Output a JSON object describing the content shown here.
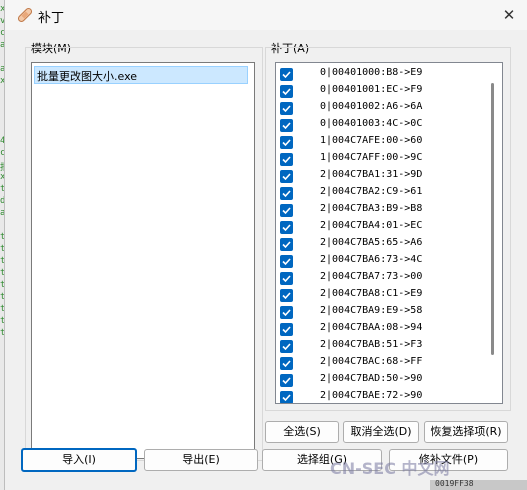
{
  "window": {
    "title": "补丁",
    "close_glyph": "✕"
  },
  "modules": {
    "label": "模块(M)",
    "items": [
      "批量更改图大小.exe"
    ]
  },
  "patches": {
    "label": "补丁(A)",
    "items": [
      "0|00401000:B8->E9",
      "0|00401001:EC->F9",
      "0|00401002:A6->6A",
      "0|00401003:4C->0C",
      "1|004C7AFE:00->60",
      "1|004C7AFF:00->9C",
      "2|004C7BA1:31->9D",
      "2|004C7BA2:C9->61",
      "2|004C7BA3:B9->B8",
      "2|004C7BA4:01->EC",
      "2|004C7BA5:65->A6",
      "2|004C7BA6:73->4C",
      "2|004C7BA7:73->00",
      "2|004C7BA8:C1->E9",
      "2|004C7BA9:E9->58",
      "2|004C7BAA:08->94",
      "2|004C7BAB:51->F3",
      "2|004C7BAC:68->FF",
      "2|004C7BAD:50->90",
      "2|004C7BAE:72->90"
    ]
  },
  "buttons": {
    "select_all": "全选(S)",
    "deselect_all": "取消全选(D)",
    "restore_selection": "恢复选择项(R)",
    "import": "导入(I)",
    "export": "导出(E)",
    "select_group": "选择组(G)",
    "patch_file": "修补文件(P)"
  },
  "background": {
    "left_strip": [
      "x",
      "v",
      "c",
      "a",
      "",
      "a",
      "x",
      "",
      "",
      "",
      "",
      "4",
      "c",
      "批",
      "x",
      "t",
      "d",
      "a",
      "",
      "t",
      "t",
      "t",
      "t",
      "t",
      "t",
      "t",
      "t",
      "t"
    ],
    "bottom_strip": "0019FF38"
  },
  "watermark": "CN-SEC 中文网",
  "colors": {
    "accent": "#0067c0",
    "selection": "#cce8ff"
  }
}
